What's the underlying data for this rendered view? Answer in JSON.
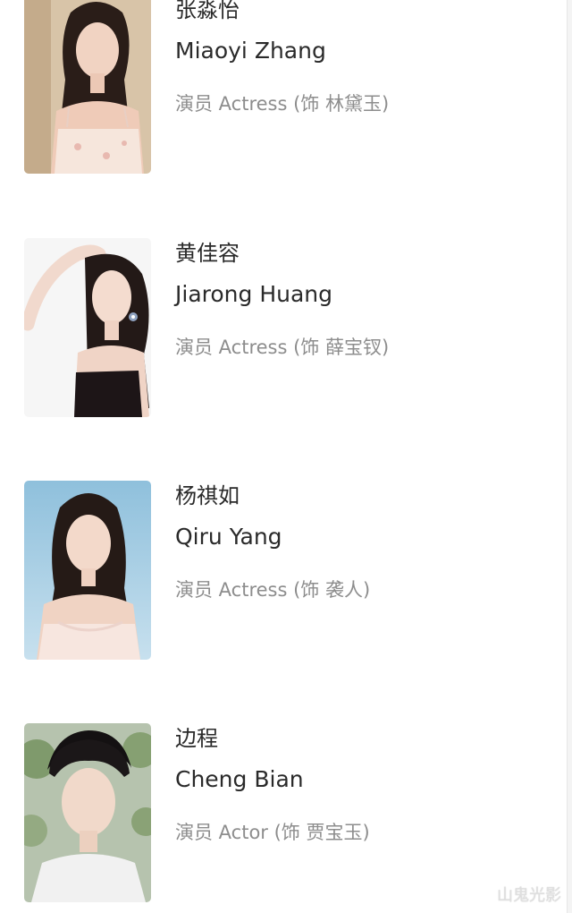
{
  "cast": [
    {
      "name_cn": "张淼怡",
      "name_en": "Miaoyi Zhang",
      "role": "演员 Actress (饰 林黛玉)",
      "photo_bg": "#d6c2a6"
    },
    {
      "name_cn": "黄佳容",
      "name_en": "Jiarong Huang",
      "role": "演员 Actress (饰 薛宝钗)",
      "photo_bg": "#f4f4f4"
    },
    {
      "name_cn": "杨祺如",
      "name_en": "Qiru Yang",
      "role": "演员 Actress (饰 袭人)",
      "photo_bg": "#9fc8df"
    },
    {
      "name_cn": "边程",
      "name_en": "Cheng Bian",
      "role": "演员 Actor (饰 贾宝玉)",
      "photo_bg": "#a9b8a0"
    }
  ],
  "watermark": "山鬼光影"
}
